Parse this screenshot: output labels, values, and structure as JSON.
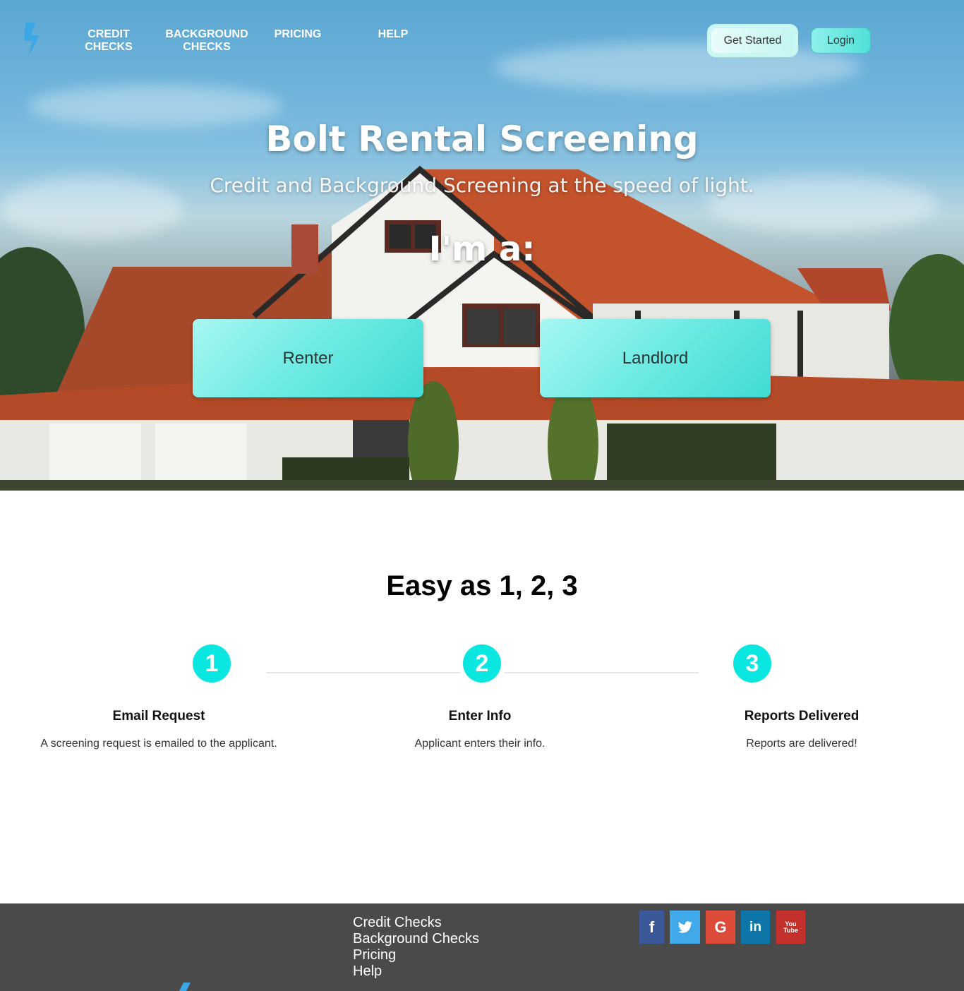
{
  "nav": {
    "items": [
      {
        "line1": "CREDIT",
        "line2": "CHECKS"
      },
      {
        "line1": "BACKGROUND",
        "line2": "CHECKS"
      },
      {
        "line1": "PRICING",
        "line2": ""
      },
      {
        "line1": "HELP",
        "line2": ""
      }
    ],
    "get_started": "Get Started",
    "login": "Login"
  },
  "hero": {
    "title": "Bolt Rental Screening",
    "subtitle": "Credit and Background Screening at the speed of light.",
    "prompt": "I'm a:",
    "renter": "Renter",
    "landlord": "Landlord"
  },
  "steps": {
    "title": "Easy as 1, 2, 3",
    "items": [
      {
        "number": "1",
        "title": "Email Request",
        "desc": "A screening request is emailed to the applicant."
      },
      {
        "number": "2",
        "title": "Enter Info",
        "desc": "Applicant enters their info."
      },
      {
        "number": "3",
        "title": "Reports Delivered",
        "desc": "Reports are delivered!"
      }
    ]
  },
  "footer": {
    "links": [
      "Credit Checks",
      "Background Checks",
      "Pricing",
      "Help"
    ],
    "social": [
      {
        "icon": "facebook-icon",
        "glyph": "f",
        "color": "#3b5998"
      },
      {
        "icon": "twitter-icon",
        "glyph": "🐦",
        "color": "#3fa9ea"
      },
      {
        "icon": "google-icon",
        "glyph": "G",
        "color": "#dd4b39"
      },
      {
        "icon": "linkedin-icon",
        "glyph": "in",
        "color": "#0e76a8"
      },
      {
        "icon": "youtube-icon",
        "glyph": "You\nTube",
        "color": "#c4302b"
      }
    ]
  },
  "colors": {
    "accent": "#0ae6e0",
    "button_gradient_start": "#a8f6f1",
    "button_gradient_end": "#3fdbd4",
    "logo_blue": "#3ba7e6",
    "footer_bg": "#4a4a4a"
  }
}
